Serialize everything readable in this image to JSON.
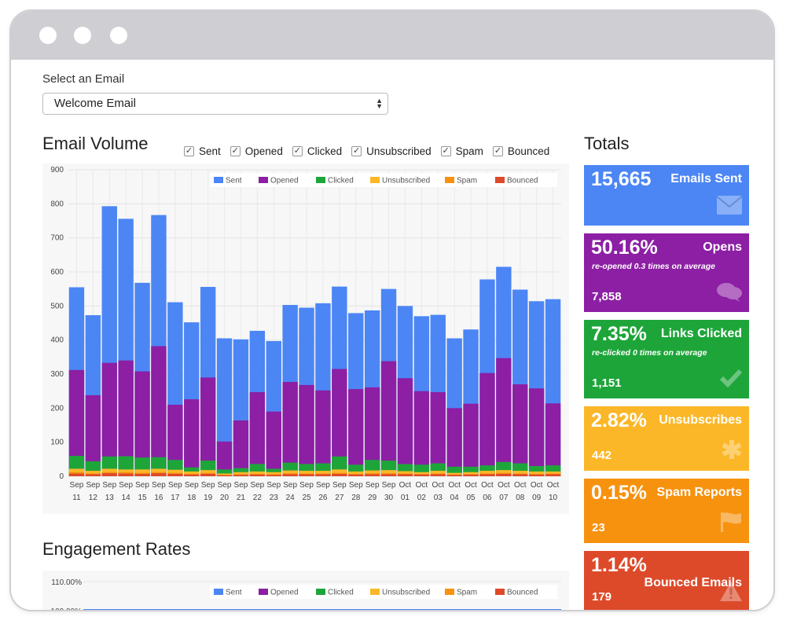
{
  "window_dots": [
    "",
    "",
    ""
  ],
  "select": {
    "label": "Select an Email",
    "value": "Welcome Email"
  },
  "email_volume": {
    "title": "Email Volume",
    "toggles": [
      {
        "label": "Sent",
        "checked": true
      },
      {
        "label": "Opened",
        "checked": true
      },
      {
        "label": "Clicked",
        "checked": true
      },
      {
        "label": "Unsubscribed",
        "checked": true
      },
      {
        "label": "Spam",
        "checked": true
      },
      {
        "label": "Bounced",
        "checked": true
      }
    ]
  },
  "engagement": {
    "title": "Engagement Rates"
  },
  "totals": {
    "title": "Totals",
    "cards": [
      {
        "big": "15,665",
        "name": "Emails Sent",
        "sub": "",
        "num": "",
        "color": "#4c86f5",
        "icon": "envelope-icon"
      },
      {
        "big": "50.16%",
        "name": "Opens",
        "sub": "re-opened 0.3 times on average",
        "num": "7,858",
        "color": "#8c1fa4",
        "icon": "chat-icon"
      },
      {
        "big": "7.35%",
        "name": "Links Clicked",
        "sub": "re-clicked 0 times on average",
        "num": "1,151",
        "color": "#1ea53a",
        "icon": "checkmark-icon"
      },
      {
        "big": "2.82%",
        "name": "Unsubscribes",
        "sub": "",
        "num": "442",
        "color": "#fbb728",
        "icon": "asterisk-icon"
      },
      {
        "big": "0.15%",
        "name": "Spam Reports",
        "sub": "",
        "num": "23",
        "color": "#f7920f",
        "icon": "flag-icon"
      },
      {
        "big": "1.14%",
        "name": "Bounced Emails",
        "sub": "",
        "num": "179",
        "color": "#dd4a2a",
        "icon": "warning-icon"
      }
    ]
  },
  "chart_data": [
    {
      "type": "bar",
      "stacked": true,
      "title": "",
      "xlabel": "",
      "ylabel": "",
      "ylim": [
        0,
        900
      ],
      "yticks": [
        0,
        100,
        200,
        300,
        400,
        500,
        600,
        700,
        800,
        900
      ],
      "legend": "top-right",
      "grid": true,
      "categories": [
        [
          "Sep",
          "11"
        ],
        [
          "Sep",
          "12"
        ],
        [
          "Sep",
          "13"
        ],
        [
          "Sep",
          "14"
        ],
        [
          "Sep",
          "15"
        ],
        [
          "Sep",
          "16"
        ],
        [
          "Sep",
          "17"
        ],
        [
          "Sep",
          "18"
        ],
        [
          "Sep",
          "19"
        ],
        [
          "Sep",
          "20"
        ],
        [
          "Sep",
          "21"
        ],
        [
          "Sep",
          "22"
        ],
        [
          "Sep",
          "23"
        ],
        [
          "Sep",
          "24"
        ],
        [
          "Sep",
          "25"
        ],
        [
          "Sep",
          "26"
        ],
        [
          "Sep",
          "27"
        ],
        [
          "Sep",
          "28"
        ],
        [
          "Sep",
          "29"
        ],
        [
          "Sep",
          "30"
        ],
        [
          "Oct",
          "01"
        ],
        [
          "Oct",
          "02"
        ],
        [
          "Oct",
          "03"
        ],
        [
          "Oct",
          "04"
        ],
        [
          "Oct",
          "05"
        ],
        [
          "Oct",
          "06"
        ],
        [
          "Oct",
          "07"
        ],
        [
          "Oct",
          "08"
        ],
        [
          "Oct",
          "09"
        ],
        [
          "Oct",
          "10"
        ]
      ],
      "series": [
        {
          "name": "Sent",
          "color": "#4c86f5",
          "values": [
            555,
            473,
            793,
            756,
            568,
            767,
            511,
            452,
            556,
            405,
            402,
            427,
            397,
            503,
            495,
            508,
            557,
            479,
            487,
            550,
            500,
            470,
            474,
            405,
            431,
            578,
            615,
            548,
            514,
            520
          ]
        },
        {
          "name": "Opened",
          "color": "#8c1fa4",
          "values": [
            312,
            238,
            333,
            340,
            308,
            382,
            210,
            226,
            290,
            102,
            164,
            247,
            190,
            277,
            268,
            252,
            315,
            256,
            261,
            338,
            288,
            250,
            247,
            200,
            213,
            303,
            347,
            270,
            258,
            214
          ]
        },
        {
          "name": "Clicked",
          "color": "#1ea53a",
          "values": [
            60,
            44,
            58,
            59,
            55,
            56,
            48,
            26,
            46,
            20,
            24,
            36,
            22,
            40,
            36,
            38,
            58,
            34,
            48,
            46,
            36,
            34,
            38,
            28,
            28,
            32,
            42,
            38,
            30,
            32
          ]
        },
        {
          "name": "Unsubscribed",
          "color": "#fbb728",
          "values": [
            22,
            16,
            22,
            20,
            20,
            22,
            19,
            14,
            18,
            8,
            12,
            14,
            12,
            17,
            16,
            16,
            20,
            14,
            17,
            18,
            15,
            12,
            16,
            10,
            12,
            16,
            18,
            16,
            14,
            14
          ]
        },
        {
          "name": "Spam",
          "color": "#f7920f",
          "values": [
            12,
            8,
            12,
            12,
            10,
            12,
            10,
            7,
            10,
            4,
            6,
            7,
            6,
            9,
            8,
            8,
            10,
            7,
            9,
            9,
            8,
            7,
            8,
            5,
            6,
            8,
            10,
            8,
            7,
            8
          ]
        },
        {
          "name": "Bounced",
          "color": "#dd4a2a",
          "values": [
            8,
            6,
            9,
            8,
            7,
            9,
            7,
            5,
            7,
            3,
            4,
            5,
            4,
            6,
            6,
            6,
            7,
            5,
            6,
            6,
            6,
            5,
            6,
            4,
            5,
            6,
            7,
            6,
            5,
            6
          ]
        }
      ]
    },
    {
      "type": "line",
      "title": "",
      "ylim": [
        0,
        110
      ],
      "ytick_labels": [
        "110.00%",
        "100.00%"
      ],
      "yticks": [
        110,
        100
      ],
      "legend": "top-right",
      "series": [
        {
          "name": "Sent",
          "color": "#4c86f5",
          "values": [
            100,
            100,
            100,
            100,
            100,
            100,
            100,
            100,
            100,
            100,
            100,
            100,
            100,
            100,
            100,
            100,
            100,
            100,
            100,
            100,
            100,
            100,
            100,
            100,
            100,
            100,
            100,
            100,
            100,
            100
          ]
        },
        {
          "name": "Opened",
          "color": "#8c1fa4",
          "values": []
        },
        {
          "name": "Clicked",
          "color": "#1ea53a",
          "values": []
        },
        {
          "name": "Unsubscribed",
          "color": "#fbb728",
          "values": []
        },
        {
          "name": "Spam",
          "color": "#f7920f",
          "values": []
        },
        {
          "name": "Bounced",
          "color": "#dd4a2a",
          "values": []
        }
      ]
    }
  ]
}
